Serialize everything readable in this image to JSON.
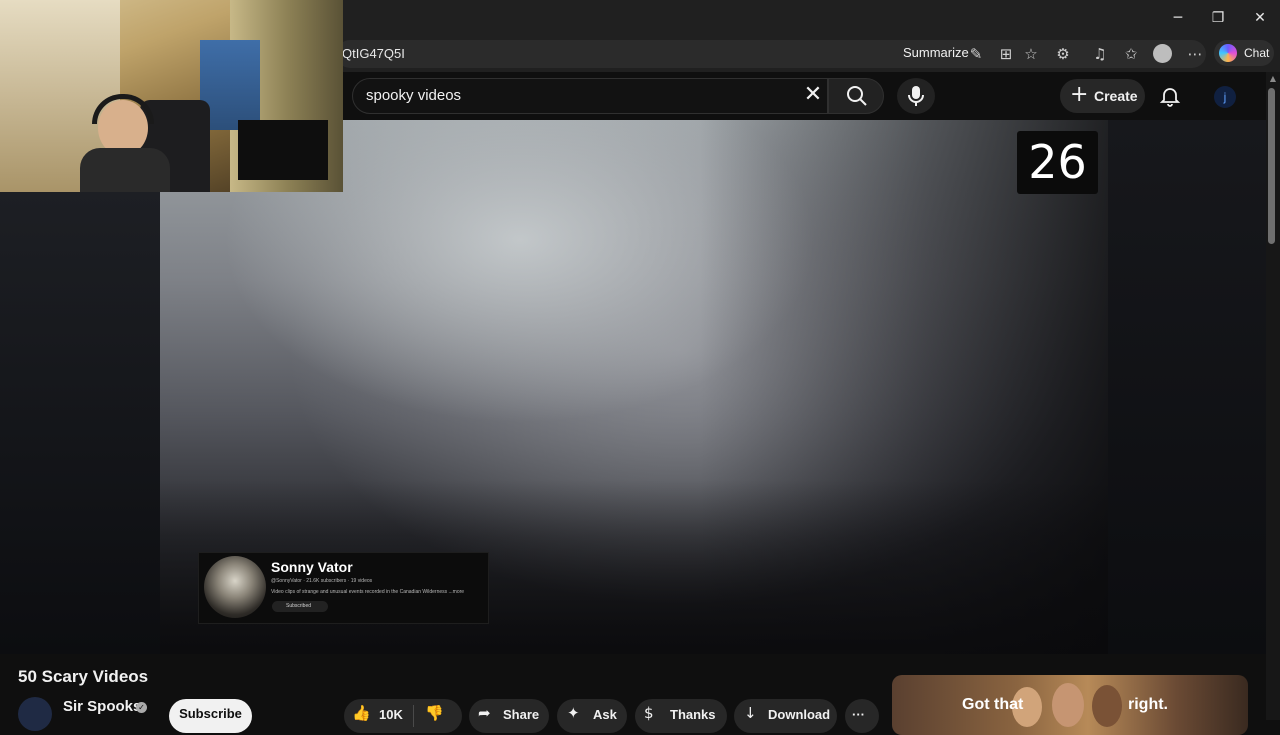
{
  "browser": {
    "window_controls": {
      "minimize": "─",
      "restore": "❐",
      "close": "✕"
    },
    "url_fragment": "QtIG47Q5I",
    "summarize_label": "Summarize",
    "chat_label": "Chat"
  },
  "youtube": {
    "search": {
      "value": "spooky videos"
    },
    "create_label": "Create",
    "avatar_letter": "j"
  },
  "video": {
    "counter": "26",
    "channel_card": {
      "name": "Sonny Vator",
      "meta": "@SonnyVator · 21.6K subscribers · 19 videos",
      "description": "Video clips of strange and unusual events recorded in the Canadian Wilderness ...more",
      "subscribed_label": "Subscribed"
    }
  },
  "info": {
    "title": "50 Scary Videos",
    "channel_name": "Sir Spooks",
    "subscribe_label": "Subscribe",
    "like_count": "10K",
    "share_label": "Share",
    "ask_label": "Ask",
    "thanks_label": "Thanks",
    "download_label": "Download",
    "more_label": "···"
  },
  "ad": {
    "text_left": "Got that",
    "text_right": "right."
  },
  "colors": {
    "background": "#0f0f0f",
    "browser_chrome": "#202020",
    "pill": "#272727"
  }
}
